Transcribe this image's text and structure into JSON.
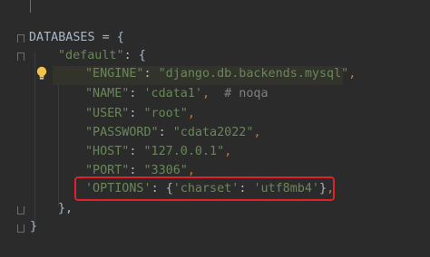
{
  "code": {
    "line1": {
      "name": "DATABASES",
      "eq": " = ",
      "brace": "{"
    },
    "line2": {
      "key": "\"default\"",
      "colon": ": ",
      "brace": "{"
    },
    "line3": {
      "key": "\"ENGINE\"",
      "colon": ": ",
      "value": "\"django.db.backends.mysql\"",
      "comma": ","
    },
    "line4": {
      "key": "\"NAME\"",
      "colon": ": ",
      "value": "'cdata1'",
      "comma": ",",
      "comment": "  # noqa"
    },
    "line5": {
      "key": "\"USER\"",
      "colon": ": ",
      "value": "\"root\"",
      "comma": ","
    },
    "line6": {
      "key": "\"PASSWORD\"",
      "colon": ": ",
      "value": "\"cdata2022\"",
      "comma": ","
    },
    "line7": {
      "key": "\"HOST\"",
      "colon": ": ",
      "value": "\"127.0.0.1\"",
      "comma": ","
    },
    "line8": {
      "key": "\"PORT\"",
      "colon": ": ",
      "value": "\"3306\"",
      "comma": ","
    },
    "line9": {
      "key": "'OPTIONS'",
      "colon": ": ",
      "open": "{",
      "inner_key": "'charset'",
      "inner_colon": ": ",
      "inner_value": "'utf8mb4'",
      "close": "}",
      "comma": ","
    },
    "line10": {
      "text": "},"
    },
    "line11": {
      "text": "}"
    }
  },
  "icons": {
    "intention_bulb": "lightbulb-icon"
  },
  "colors": {
    "background": "#2b2b2b",
    "string": "#6a8759",
    "operator": "#cc7832",
    "identifier": "#a9b7c6",
    "comment": "#808080",
    "highlight_border": "#e0202a",
    "bulb": "#f2c14e"
  }
}
